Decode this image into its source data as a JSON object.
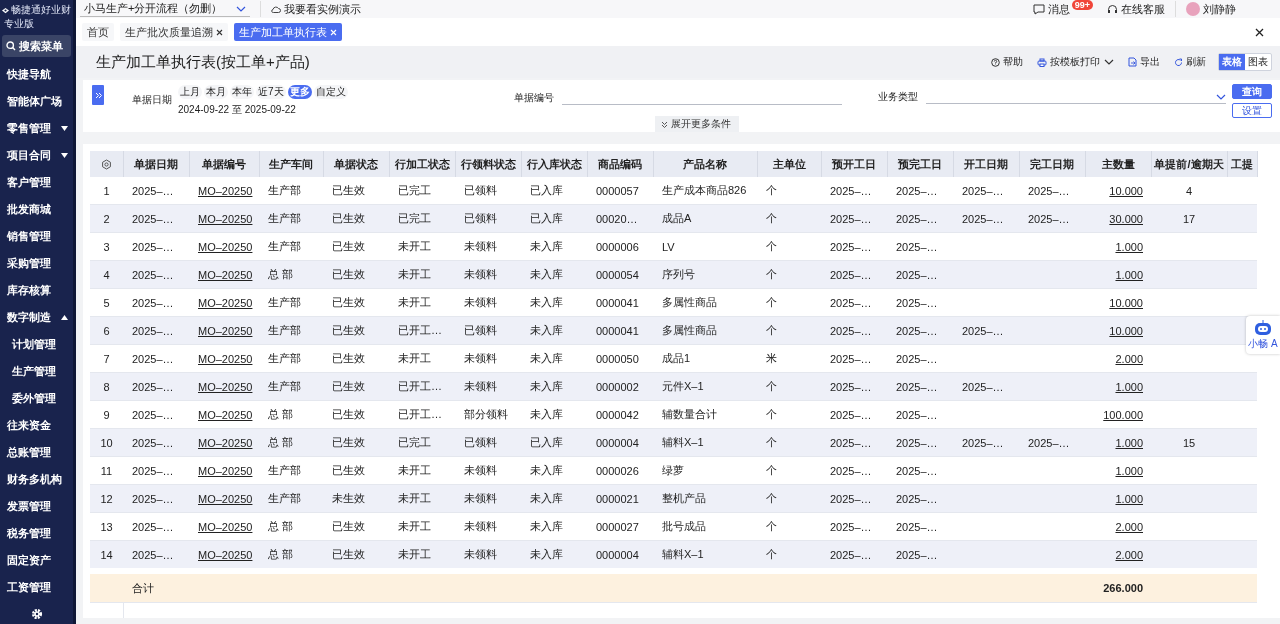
{
  "sidebar": {
    "logo_text": "畅捷通好业财",
    "edition": "专业版",
    "search_label": "搜索菜单",
    "items": [
      {
        "label": "快捷导航",
        "kind": "link"
      },
      {
        "label": "智能体广场",
        "kind": "link"
      },
      {
        "label": "零售管理",
        "kind": "group",
        "expanded": false
      },
      {
        "label": "项目合同",
        "kind": "group",
        "expanded": false
      },
      {
        "label": "客户管理",
        "kind": "link"
      },
      {
        "label": "批发商城",
        "kind": "link"
      },
      {
        "label": "销售管理",
        "kind": "link"
      },
      {
        "label": "采购管理",
        "kind": "link"
      },
      {
        "label": "库存核算",
        "kind": "link"
      },
      {
        "label": "数字制造",
        "kind": "group",
        "expanded": true,
        "children": [
          {
            "label": "计划管理"
          },
          {
            "label": "生产管理"
          },
          {
            "label": "委外管理"
          }
        ]
      },
      {
        "label": "往来资金",
        "kind": "link"
      },
      {
        "label": "总账管理",
        "kind": "link"
      },
      {
        "label": "财务多机构",
        "kind": "link"
      },
      {
        "label": "发票管理",
        "kind": "link"
      },
      {
        "label": "税务管理",
        "kind": "link"
      },
      {
        "label": "固定资产",
        "kind": "link"
      },
      {
        "label": "工资管理",
        "kind": "link"
      }
    ]
  },
  "topbar": {
    "account_select": "小马生产+分开流程（勿删）",
    "demo_link": "我要看实例演示",
    "messages": "消息",
    "messages_badge": "99+",
    "support": "在线客服",
    "user": "刘静静"
  },
  "tabs": [
    {
      "label": "首页",
      "closable": false,
      "selected": false
    },
    {
      "label": "生产批次质量追溯",
      "closable": true,
      "selected": false
    },
    {
      "label": "生产加工单执行表",
      "closable": true,
      "selected": true
    }
  ],
  "page": {
    "title": "生产加工单执行表(按工单+产品)",
    "actions": [
      "帮助",
      "按模板打印",
      "导出",
      "刷新"
    ],
    "views": [
      {
        "label": "表格",
        "selected": true
      },
      {
        "label": "图表",
        "selected": false
      }
    ]
  },
  "filters": {
    "date_label": "单据日期",
    "date_chips": [
      {
        "label": "上月",
        "selected": false
      },
      {
        "label": "本月",
        "selected": false
      },
      {
        "label": "本年",
        "selected": false
      },
      {
        "label": "近7天",
        "selected": false
      },
      {
        "label": "更多",
        "selected": true
      },
      {
        "label": "自定义",
        "selected": false
      }
    ],
    "date_range": "2024-09-22 至 2025-09-22",
    "number_label": "单据编号",
    "type_label": "业务类型",
    "query_button": "查询",
    "settings_button": "设置",
    "expand_button": "展开更多条件"
  },
  "table": {
    "columns": [
      "",
      "单据日期",
      "单据编号",
      "生产车间",
      "单据状态",
      "行加工状态",
      "行领料状态",
      "行入库状态",
      "商品编码",
      "产品名称",
      "主单位",
      "预开工日",
      "预完工日",
      "开工日期",
      "完工日期",
      "主数量",
      "单提前/逾期天",
      "工提"
    ],
    "rows": [
      [
        "1",
        "2025–…",
        "MO–20250",
        "生产部",
        "已生效",
        "已完工",
        "已领料",
        "已入库",
        "0000057",
        "生产成本商品826",
        "个",
        "2025–…",
        "2025–…",
        "2025–…",
        "2025–…",
        "10.000",
        "4"
      ],
      [
        "2",
        "2025–…",
        "MO–20250",
        "生产部",
        "已生效",
        "已完工",
        "已领料",
        "已入库",
        "00020…",
        "成品A",
        "个",
        "2025–…",
        "2025–…",
        "2025–…",
        "2025–…",
        "30.000",
        "17"
      ],
      [
        "3",
        "2025–…",
        "MO–20250",
        "生产部",
        "已生效",
        "未开工",
        "未领料",
        "未入库",
        "0000006",
        "LV",
        "个",
        "2025–…",
        "2025–…",
        null,
        null,
        "1.000",
        null
      ],
      [
        "4",
        "2025–…",
        "MO–20250",
        "总 部",
        "已生效",
        "未开工",
        "未领料",
        "未入库",
        "0000054",
        "序列号",
        "个",
        "2025–…",
        "2025–…",
        null,
        null,
        "1.000",
        null
      ],
      [
        "5",
        "2025–…",
        "MO–20250",
        "生产部",
        "已生效",
        "未开工",
        "未领料",
        "未入库",
        "0000041",
        "多属性商品",
        "个",
        "2025–…",
        "2025–…",
        null,
        null,
        "10.000",
        null
      ],
      [
        "6",
        "2025–…",
        "MO–20250",
        "生产部",
        "已生效",
        "已开工…",
        "已领料",
        "未入库",
        "0000041",
        "多属性商品",
        "个",
        "2025–…",
        "2025–…",
        "2025–…",
        null,
        "10.000",
        null
      ],
      [
        "7",
        "2025–…",
        "MO–20250",
        "生产部",
        "已生效",
        "未开工",
        "未领料",
        "未入库",
        "0000050",
        "成品1",
        "米",
        "2025–…",
        "2025–…",
        null,
        null,
        "2.000",
        null
      ],
      [
        "8",
        "2025–…",
        "MO–20250",
        "生产部",
        "已生效",
        "已开工…",
        "未领料",
        "未入库",
        "0000002",
        "元件X–1",
        "个",
        "2025–…",
        "2025–…",
        "2025–…",
        null,
        "1.000",
        null
      ],
      [
        "9",
        "2025–…",
        "MO–20250",
        "总 部",
        "已生效",
        "已开工…",
        "部分领料",
        "未入库",
        "0000042",
        "辅数量合计",
        "个",
        "2025–…",
        "2025–…",
        null,
        null,
        "100.000",
        null
      ],
      [
        "10",
        "2025–…",
        "MO–20250",
        "总 部",
        "已生效",
        "已完工",
        "已领料",
        "已入库",
        "0000004",
        "辅料X–1",
        "个",
        "2025–…",
        "2025–…",
        "2025–…",
        "2025–…",
        "1.000",
        "15"
      ],
      [
        "11",
        "2025–…",
        "MO–20250",
        "生产部",
        "已生效",
        "未开工",
        "未领料",
        "未入库",
        "0000026",
        "绿萝",
        "个",
        "2025–…",
        "2025–…",
        null,
        null,
        "1.000",
        null
      ],
      [
        "12",
        "2025–…",
        "MO–20250",
        "生产部",
        "未生效",
        "未开工",
        "未领料",
        "未入库",
        "0000021",
        "整机产品",
        "个",
        "2025–…",
        "2025–…",
        null,
        null,
        "1.000",
        null
      ],
      [
        "13",
        "2025–…",
        "MO–20250",
        "总 部",
        "已生效",
        "未开工",
        "未领料",
        "未入库",
        "0000027",
        "批号成品",
        "个",
        "2025–…",
        "2025–…",
        null,
        null,
        "2.000",
        null
      ],
      [
        "14",
        "2025–…",
        "MO–20250",
        "总 部",
        "已生效",
        "未开工",
        "未领料",
        "未入库",
        "0000004",
        "辅料X–1",
        "个",
        "2025–…",
        "2025–…",
        null,
        null,
        "2.000",
        null
      ]
    ],
    "total_label": "合计",
    "total_quantity": "266.000"
  },
  "assistant": {
    "label": "小畅 A"
  }
}
